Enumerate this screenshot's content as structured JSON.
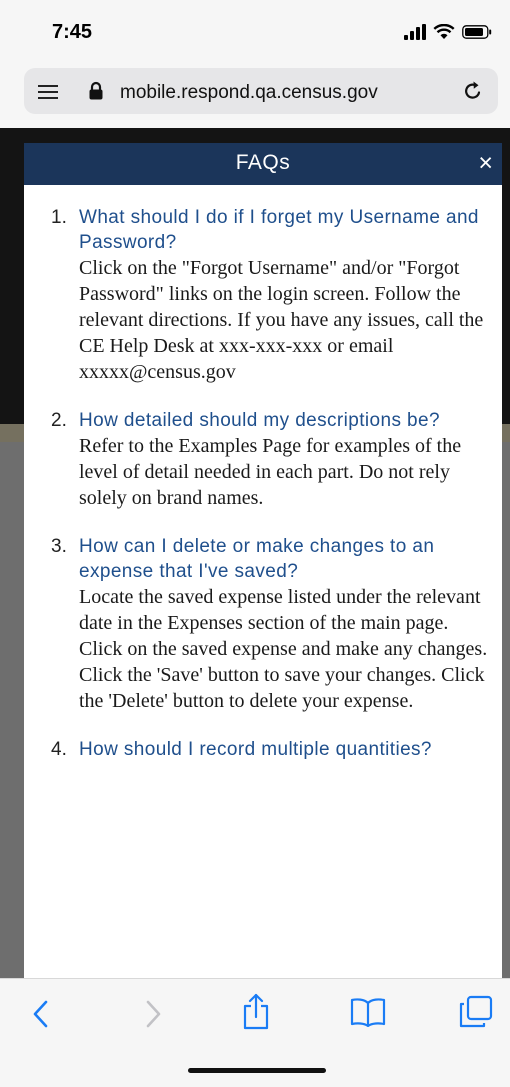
{
  "status_bar": {
    "time": "7:45",
    "icons": [
      "signal-icon",
      "wifi-icon",
      "battery-icon"
    ]
  },
  "browser": {
    "url": "mobile.respond.qa.census.gov"
  },
  "modal": {
    "title": "FAQs",
    "close_glyph": "×",
    "faqs": [
      {
        "number": "1.",
        "question": "What should I do if I forget my Username and Password?",
        "answer": "Click on the \"Forgot Username\" and/or \"Forgot Password\" links on the login screen. Follow the relevant directions. If you have any issues, call the CE Help Desk at xxx-xxx-xxx or email xxxxx@census.gov"
      },
      {
        "number": "2.",
        "question": "How detailed should my descriptions be?",
        "answer": "Refer to the Examples Page for examples of the level of detail needed in each part. Do not rely solely on brand names."
      },
      {
        "number": "3.",
        "question": "How can I delete or make changes to an expense that I've saved?",
        "answer": "Locate the saved expense listed under the relevant date in the Expenses section of the main page. Click on the saved expense and make any changes. Click the 'Save' button to save your changes. Click the 'Delete' button to delete your expense."
      },
      {
        "number": "4.",
        "question": "How should I record multiple quantities?",
        "answer": ""
      }
    ]
  },
  "toolbar": {
    "icons": [
      "back-icon",
      "forward-icon",
      "share-icon",
      "bookmarks-icon",
      "tabs-icon"
    ]
  },
  "colors": {
    "header_bg": "#1b355a",
    "question_text": "#1f4f8c"
  }
}
